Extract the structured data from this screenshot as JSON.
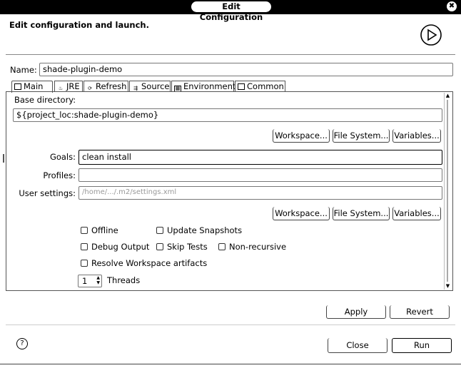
{
  "window": {
    "title": "Edit Configuration",
    "close_glyph": "✖"
  },
  "header": {
    "text": "Edit configuration and launch.",
    "logo": "run-configuration-icon"
  },
  "name": {
    "label": "Name:",
    "value": "shade-plugin-demo"
  },
  "tabs": [
    {
      "label": "Main",
      "icon": "maven-main-icon",
      "selected": true
    },
    {
      "label": "JRE",
      "icon": "jre-icon"
    },
    {
      "label": "Refresh",
      "icon": "refresh-icon"
    },
    {
      "label": "Source",
      "icon": "source-icon"
    },
    {
      "label": "Environment",
      "icon": "environment-icon"
    },
    {
      "label": "Common",
      "icon": "common-icon"
    }
  ],
  "main": {
    "base_dir_label": "Base directory:",
    "base_dir_value": "${project_loc:shade-plugin-demo}",
    "buttons": {
      "workspace": "Workspace...",
      "file_system": "File System...",
      "variables": "Variables..."
    },
    "goals_label": "Goals:",
    "goals_value": "clean install",
    "profiles_label": "Profiles:",
    "profiles_value": "",
    "user_settings_label": "User settings:",
    "user_settings_value": "/home/.../.m2/settings.xml",
    "checkboxes": {
      "offline": "Offline",
      "update_snapshots": "Update Snapshots",
      "debug_output": "Debug Output",
      "skip_tests": "Skip Tests",
      "non_recursive": "Non-recursive",
      "resolve_workspace": "Resolve Workspace artifacts"
    },
    "threads_value": "1",
    "threads_label": "Threads"
  },
  "actions": {
    "apply": "Apply",
    "revert": "Revert",
    "close": "Close",
    "run": "Run"
  },
  "help_glyph": "?"
}
